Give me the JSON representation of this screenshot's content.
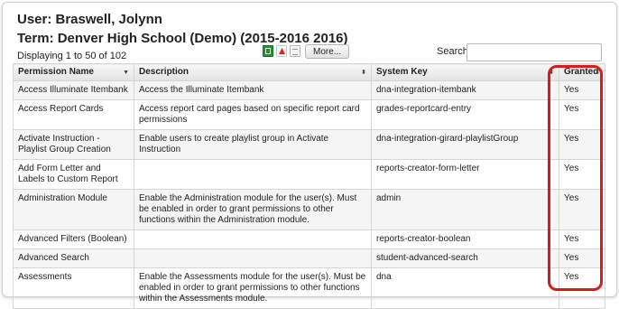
{
  "header": {
    "user_line": "User: Braswell, Jolynn",
    "term_line": "Term: Denver High School (Demo) (2015-2016 2016)"
  },
  "toolbar": {
    "display_info": "Displaying 1 to 50 of 102",
    "more_label": "More...",
    "search_label": "Search",
    "search_value": "",
    "export_icons": [
      "excel-icon",
      "pdf-icon",
      "print-icon"
    ]
  },
  "table": {
    "columns": [
      "Permission Name",
      "Description",
      "System Key",
      "Granted"
    ],
    "rows": [
      {
        "name": "Access Illuminate Itembank",
        "description": "Access the Illuminate Itembank",
        "key": "dna-integration-itembank",
        "granted": "Yes"
      },
      {
        "name": "Access Report Cards",
        "description": "Access report card pages based on specific report card permissions",
        "key": "grades-reportcard-entry",
        "granted": "Yes"
      },
      {
        "name": "Activate Instruction - Playlist Group Creation",
        "description": "Enable users to create playlist group in Activate Instruction",
        "key": "dna-integration-girard-playlistGroup",
        "granted": "Yes"
      },
      {
        "name": "Add Form Letter and Labels to Custom Report",
        "description": "",
        "key": "reports-creator-form-letter",
        "granted": "Yes"
      },
      {
        "name": "Administration Module",
        "description": "Enable the Administration module for the user(s). Must be enabled in order to grant permissions to other functions within the Administration module.",
        "key": "admin",
        "granted": "Yes"
      },
      {
        "name": "Advanced Filters (Boolean)",
        "description": "",
        "key": "reports-creator-boolean",
        "granted": "Yes"
      },
      {
        "name": "Advanced Search",
        "description": "",
        "key": "student-advanced-search",
        "granted": "Yes"
      },
      {
        "name": "Assessments",
        "description": "Enable the Assessments module for the user(s). Must be enabled in order to grant permissions to other functions within the Assessments module.",
        "key": "dna",
        "granted": "Yes"
      }
    ]
  },
  "colors": {
    "highlight": "#d51d1d",
    "zebra": "#f5f5f5",
    "border": "#d6d6d6"
  }
}
